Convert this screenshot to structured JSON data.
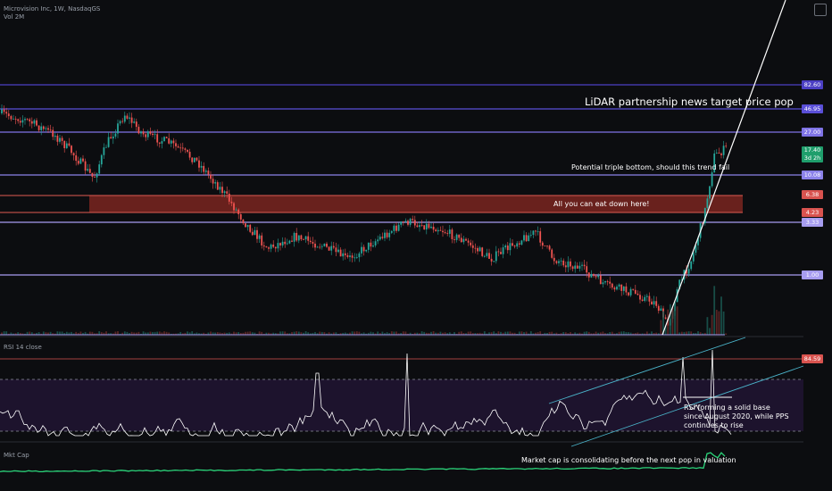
{
  "header": {
    "symbol": "Microvision Inc, 1W, NasdaqGS",
    "volume_label": "Vol 2M"
  },
  "indicators": {
    "rsi_label": "RSI 14 close",
    "mcap_label": "Mkt Cap"
  },
  "price_levels": [
    {
      "label": "82.60",
      "color": "#4b3fc4"
    },
    {
      "label": "46.95",
      "color": "#5a4fd8"
    },
    {
      "label": "27.00",
      "color": "#7f73e6"
    },
    {
      "label": "10.08",
      "color": "#8c82ea"
    },
    {
      "label": "6.38",
      "color": "#d9534f"
    },
    {
      "label": "4.23",
      "color": "#d9534f"
    },
    {
      "label": "3.33",
      "color": "#a79df0"
    },
    {
      "label": "1.00",
      "color": "#a79df0"
    }
  ],
  "current_price": {
    "price": "17.40",
    "countdown": "3d 2h",
    "color": "#1f9e6c"
  },
  "rsi_level": {
    "label": "84.59",
    "color": "#d9534f"
  },
  "annotations": {
    "lidar": "LiDAR partnership news target price pop",
    "triple_bottom": "Potential triple bottom, should this trend fail",
    "eat_down": "All you can eat down here!",
    "rsi_base_1": "RSI forming a solid base",
    "rsi_base_2": "since August 2020, while PPS",
    "rsi_base_3": "continues to rise",
    "mcap": "Market cap is consolidating before the next pop in valuation"
  },
  "colors": {
    "up_candle": "#26a69a",
    "down_candle": "#ef5350",
    "rsi_line": "#ffffff",
    "rsi_band": "#2b1a45",
    "mcap_line": "#2bd47a",
    "support_zone": "#7a2620",
    "trendline": "#ffffff",
    "channel": "#4ab3c9"
  }
}
